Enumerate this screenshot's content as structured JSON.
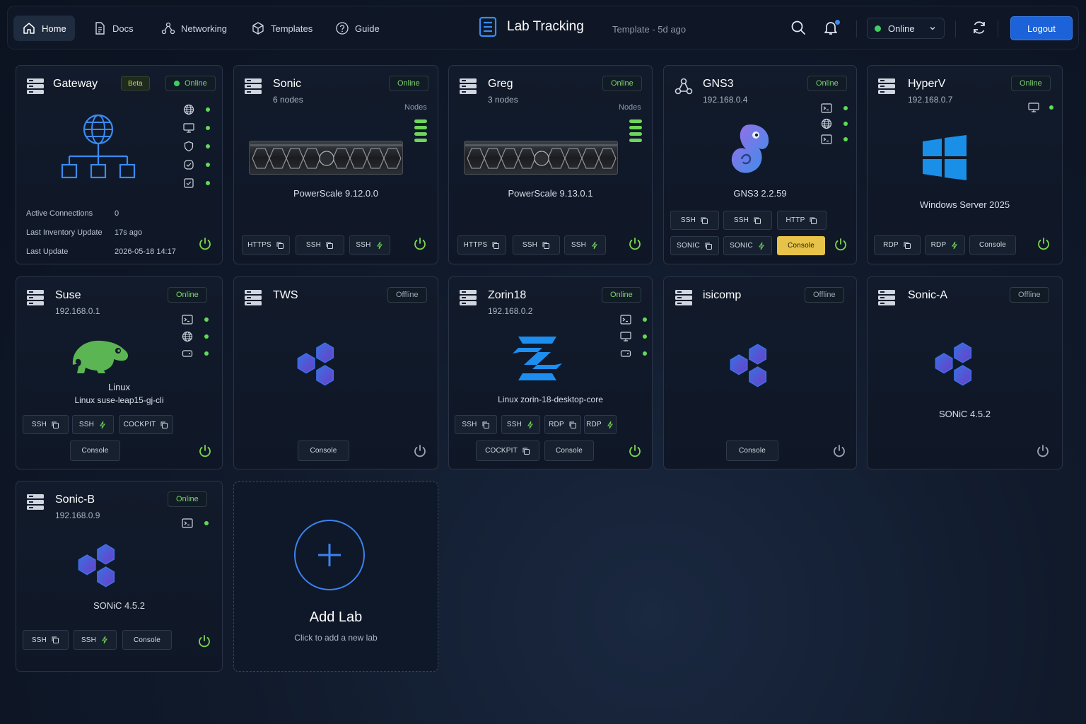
{
  "nav": {
    "home": "Home",
    "docs": "Docs",
    "networking": "Networking",
    "templates": "Templates",
    "guide": "Guide"
  },
  "app": {
    "title": "Lab Tracking",
    "subtitle": "Template - 5d ago"
  },
  "status_select": {
    "value": "Online"
  },
  "logout": "Logout",
  "colors": {
    "online": "#3fcf5f",
    "accent": "#1c62d8",
    "console_highlight": "#e7c34a"
  },
  "cards": {
    "gateway": {
      "title": "Gateway",
      "beta": "Beta",
      "status": "Online",
      "info": [
        {
          "label": "Active Connections",
          "value": "0"
        },
        {
          "label": "Last Inventory Update",
          "value": "17s ago"
        },
        {
          "label": "Last Update",
          "value": "2026-05-18 14:17"
        }
      ]
    },
    "sonic": {
      "title": "Sonic",
      "sub": "6 nodes",
      "status": "Online",
      "nodes_label": "Nodes",
      "label": "PowerScale 9.12.0.0",
      "buttons": [
        "HTTPS",
        "SSH",
        "SSH"
      ]
    },
    "greg": {
      "title": "Greg",
      "sub": "3 nodes",
      "status": "Online",
      "nodes_label": "Nodes",
      "label": "PowerScale 9.13.0.1",
      "buttons": [
        "HTTPS",
        "SSH",
        "SSH"
      ]
    },
    "gns3": {
      "title": "GNS3",
      "sub": "192.168.0.4",
      "status": "Online",
      "label": "GNS3 2.2.59",
      "buttons": [
        "SSH",
        "SSH",
        "HTTP",
        "SONIC",
        "SONIC",
        "Console"
      ]
    },
    "hyperv": {
      "title": "HyperV",
      "sub": "192.168.0.7",
      "status": "Online",
      "label": "Windows Server 2025",
      "buttons": [
        "RDP",
        "RDP",
        "Console"
      ]
    },
    "suse": {
      "title": "Suse",
      "sub": "192.168.0.1",
      "status": "Online",
      "label1": "Linux",
      "label2": "Linux suse-leap15-gj-cli",
      "buttons": [
        "SSH",
        "SSH",
        "COCKPIT",
        "Console"
      ]
    },
    "tws": {
      "title": "TWS",
      "status": "Offline",
      "buttons": [
        "Console"
      ]
    },
    "zorin18": {
      "title": "Zorin18",
      "sub": "192.168.0.2",
      "status": "Online",
      "label": "Linux zorin-18-desktop-core",
      "buttons": [
        "SSH",
        "SSH",
        "RDP",
        "RDP",
        "COCKPIT",
        "Console"
      ]
    },
    "isicomp": {
      "title": "isicomp",
      "status": "Offline",
      "buttons": [
        "Console"
      ]
    },
    "sonic_a": {
      "title": "Sonic-A",
      "status": "Offline",
      "label": "SONiC 4.5.2"
    },
    "sonic_b": {
      "title": "Sonic-B",
      "sub": "192.168.0.9",
      "status": "Online",
      "label": "SONiC 4.5.2",
      "buttons": [
        "SSH",
        "SSH",
        "Console"
      ]
    },
    "add_lab": {
      "title": "Add Lab",
      "sub": "Click to add a new lab"
    }
  }
}
